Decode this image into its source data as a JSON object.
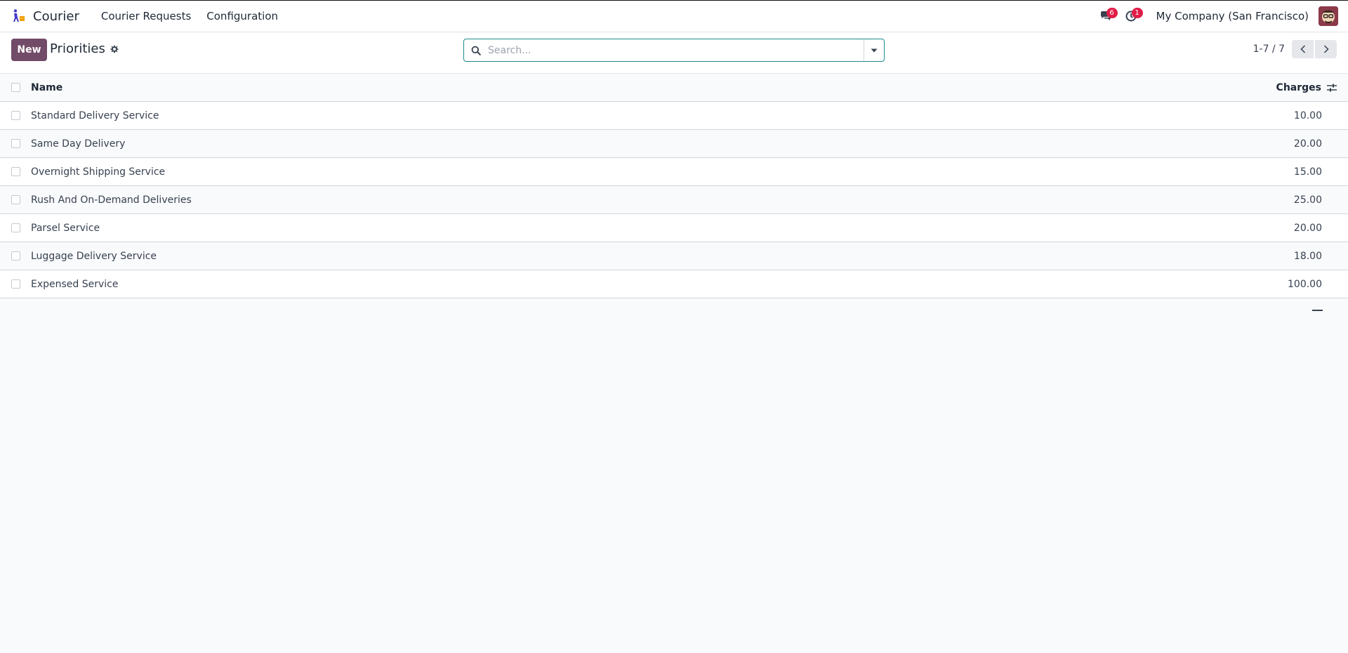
{
  "app": {
    "name": "Courier",
    "menu": [
      "Courier Requests",
      "Configuration"
    ]
  },
  "systray": {
    "messages_count": "6",
    "activities_count": "1",
    "company": "My Company (San Francisco)"
  },
  "control_panel": {
    "new_label": "New",
    "title": "Priorities",
    "search_placeholder": "Search...",
    "pager": "1-7 / 7"
  },
  "table": {
    "columns": [
      "Name",
      "Charges"
    ],
    "rows": [
      {
        "name": "Standard Delivery Service",
        "charges": "10.00"
      },
      {
        "name": "Same Day Delivery",
        "charges": "20.00"
      },
      {
        "name": "Overnight Shipping Service",
        "charges": "15.00"
      },
      {
        "name": "Rush And On-Demand Deliveries",
        "charges": "25.00"
      },
      {
        "name": "Parsel Service",
        "charges": "20.00"
      },
      {
        "name": "Luggage Delivery Service",
        "charges": "18.00"
      },
      {
        "name": "Expensed Service",
        "charges": "100.00"
      }
    ]
  },
  "colors": {
    "primary": "#714b67",
    "badge": "#e11d48",
    "search_border": "#1f8a8a"
  }
}
